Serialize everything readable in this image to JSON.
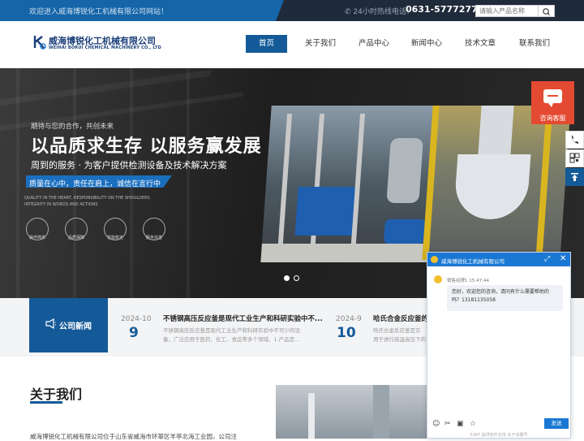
{
  "topbar": {
    "welcome": "欢迎进入威海博锐化工机械有限公司网站！",
    "hotline_label": "24小时热线电话：",
    "hotline": "0631-5777277",
    "search_placeholder": "请输入产品名称"
  },
  "logo": {
    "name_cn": "威海博锐化工机械有限公司",
    "name_en": "WEIHAI BORUI CHEMICAL MACHINERY CO., LTD"
  },
  "nav": {
    "items": [
      {
        "label": "首页"
      },
      {
        "label": "关于我们"
      },
      {
        "label": "产品中心"
      },
      {
        "label": "新闻中心"
      },
      {
        "label": "技术文章"
      },
      {
        "label": "联系我们"
      }
    ]
  },
  "banner": {
    "sub": "期待与您的合作，共创未来",
    "title": "以品质求生存  以服务赢发展",
    "line": "周到的服务 · 为客户提供检测设备及技术解决方案",
    "tag": "质量在心中，责任在肩上，诚信在言行中",
    "en_1": "QUALITY IN THE HEART, RESPONSIBILITY ON THE SHOULDERS",
    "en_2": "INTEGRITY IN WORDS AND ACTIONS",
    "features": [
      "操作简单",
      "品质保障",
      "性能稳定",
      "服务完善"
    ],
    "active_slide": 1,
    "slide_count": 2
  },
  "news": {
    "label": "公司新闻",
    "items": [
      {
        "date": "2024-10",
        "day": "9",
        "title": "不锈钢高压反应釜是现代工业生产和科研实验中不...",
        "desc_1": "不锈钢高压反应釜是现代工业生产和科研实验中不可少的设",
        "desc_2": "备，广泛应用于医药、化工、食品等多个领域，1.产品定..."
      },
      {
        "date": "2024-9",
        "day": "10",
        "title": "哈氏合金反应釜的",
        "desc_1": "哈氏合金反应釜是实",
        "desc_2": "用于进行高温高压下的"
      }
    ]
  },
  "about": {
    "title": "关于我们",
    "text": "威海博锐化工机械有限公司位于山东省威海市环翠区羊亭北海工业园，公司注"
  },
  "consult": {
    "label": "咨询客服"
  },
  "chat": {
    "title": "威海博锐化工机械有限公司",
    "agent": "销售经理1",
    "time": "15:47:44",
    "message": "您好，欢迎您的咨询，请问有什么需要帮助的吗？13181135058",
    "send": "发送",
    "powered": "53KF 提供软件支持   关于该服号"
  },
  "colors": {
    "brand_blue": "#145a98",
    "top_dark": "#1f2a3a",
    "consult_red": "#e44a32",
    "chat_blue": "#1a78d4"
  }
}
